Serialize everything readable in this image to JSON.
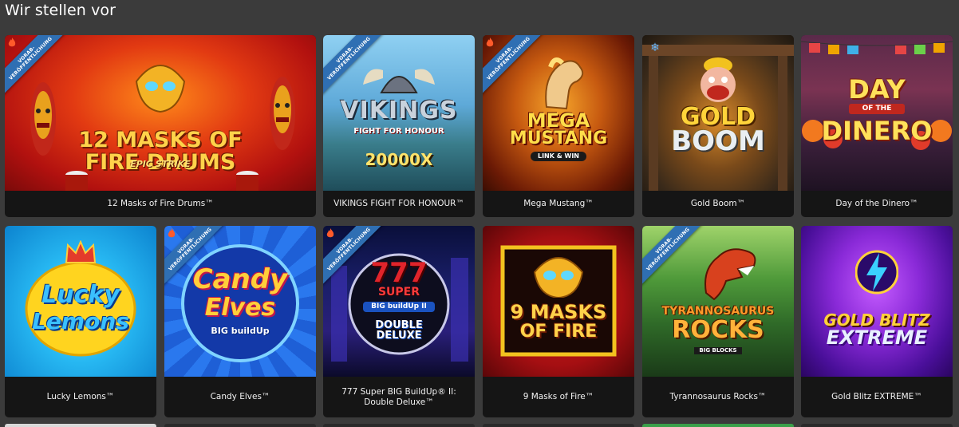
{
  "section": {
    "title": "Wir stellen vor"
  },
  "ribbon": {
    "line1": "VORAB-",
    "line2": "VERÖFFENTLICHUNG"
  },
  "games": [
    {
      "name": "12 Masks of Fire Drums™",
      "logo_line1": "12 MASKS OF",
      "logo_line2": "FIRE DRUMS",
      "logo_line3": "EPIC STRIKE"
    },
    {
      "name": "VIKINGS FIGHT FOR HONOUR™",
      "logo_line1": "VIKINGS",
      "logo_line2": "FIGHT FOR HONOUR",
      "logo_line3": "20000X"
    },
    {
      "name": "Mega Mustang™",
      "logo_line1": "MEGA",
      "logo_line2": "MUSTANG",
      "logo_line3": "LINK & WIN"
    },
    {
      "name": "Gold Boom™",
      "logo_line1": "GOLD",
      "logo_line2": "BOOM"
    },
    {
      "name": "Day of the Dinero™",
      "logo_line1": "DAY",
      "logo_line2": "OF THE",
      "logo_line3": "DINERO"
    },
    {
      "name": "Lucky Lemons™",
      "logo_line1": "Lucky",
      "logo_line2": "Lemons"
    },
    {
      "name": "Candy Elves™",
      "logo_line1": "Candy",
      "logo_line2": "Elves",
      "logo_line3": "BIG buildUp"
    },
    {
      "name": "777 Super BIG BuildUp® II: Double Deluxe™",
      "logo_line1": "777",
      "logo_line2": "SUPER",
      "logo_line3": "BIG buildUp II",
      "logo_line4": "DOUBLE DELUXE"
    },
    {
      "name": "9 Masks of Fire™",
      "logo_line1": "9 MASKS",
      "logo_line2": "OF FIRE"
    },
    {
      "name": "Tyrannosaurus Rocks™",
      "logo_line1": "TYRANNOSAURUS",
      "logo_line2": "ROCKS",
      "logo_line3": "BIG BLOCKS"
    },
    {
      "name": "Gold Blitz EXTREME™",
      "logo_line1": "GOLD BLITZ",
      "logo_line2": "EXTREME"
    }
  ],
  "colors": {
    "page_bg": "#3b3b3b",
    "tile_caption_bg": "#151515",
    "ribbon": "#2f6fb3"
  }
}
